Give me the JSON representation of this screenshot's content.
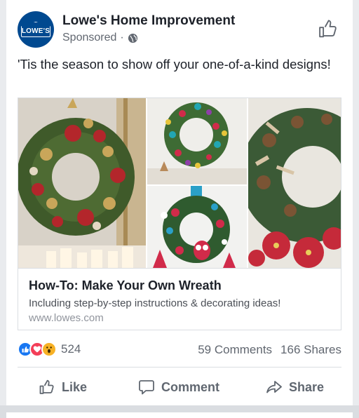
{
  "post": {
    "page_name": "Lowe's Home Improvement",
    "sponsored_label": "Sponsored",
    "meta_separator": "·",
    "avatar_logo_text": "LOWE'S",
    "body_text": "'Tis the season to show off your one-of-a-kind designs!",
    "link": {
      "title": "How-To: Make Your Own Wreath",
      "description": "Including step-by-step instructions & decorating ideas!",
      "url": "www.lowes.com"
    },
    "reactions": {
      "icons": [
        "like-reaction-icon",
        "love-reaction-icon",
        "wow-reaction-icon"
      ],
      "count": "524"
    },
    "comments_count": "59 Comments",
    "shares_count": "166 Shares",
    "actions": {
      "like": "Like",
      "comment": "Comment",
      "share": "Share"
    }
  },
  "colors": {
    "brand_blue": "#004990",
    "like_blue": "#1877f2",
    "love_red": "#f33e58",
    "wow_yellow": "#f7b125",
    "secondary_text": "#616770"
  },
  "icons": {
    "privacy": "globe-icon",
    "page_like": "thumbs-up-outline-icon",
    "action_like": "thumbs-up-outline-icon",
    "action_comment": "speech-bubble-icon",
    "action_share": "share-arrow-icon"
  }
}
